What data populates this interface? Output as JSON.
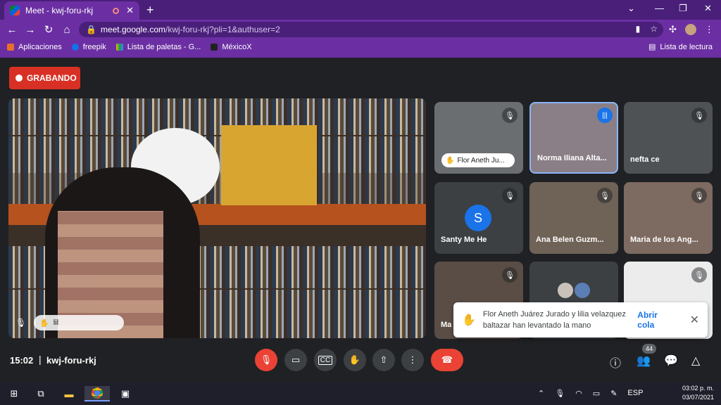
{
  "browser": {
    "tab_title": "Meet - kwj-foru-rkj",
    "url_host": "meet.google.com",
    "url_path": "/kwj-foru-rkj?pli=1&authuser=2",
    "bookmarks": [
      "Aplicaciones",
      "freepik",
      "Lista de paletas - G...",
      "MéxicoX"
    ],
    "reading_list": "Lista de lectura"
  },
  "meet": {
    "recording_label": "GRABANDO",
    "main_tile_name": "lil",
    "tiles": [
      {
        "name": "Flor Aneth Ju...",
        "muted": true,
        "hand_raised": true
      },
      {
        "name": "Norma Iliana Alta...",
        "muted": false,
        "speaking": true
      },
      {
        "name": "nefta ce",
        "muted": true
      },
      {
        "name": "Santy Me He",
        "muted": true,
        "avatar_letter": "S",
        "avatar_color": "#1a73e8"
      },
      {
        "name": "Ana Belen Guzm...",
        "muted": true
      },
      {
        "name": "Maria de los Ang...",
        "muted": true
      },
      {
        "name": "Ma",
        "muted": true
      },
      {
        "name": "",
        "muted": false
      },
      {
        "name": "",
        "muted": true
      }
    ],
    "toast": {
      "message": "Flor Aneth Juárez Jurado y lilia velazquez baltazar han levantado la mano",
      "action": "Abrir cola"
    },
    "bottom": {
      "time": "15:02",
      "separator": "|",
      "meeting_code": "kwj-foru-rkj",
      "participants_count": "44"
    }
  },
  "taskbar": {
    "lang": "ESP",
    "clock_time": "03:02 p. m.",
    "clock_date": "03/07/2021"
  },
  "colors": {
    "browser_frame": "#6b2fa3",
    "meet_bg": "#202124",
    "record_red": "#d93025",
    "accent_blue": "#1a73e8"
  }
}
